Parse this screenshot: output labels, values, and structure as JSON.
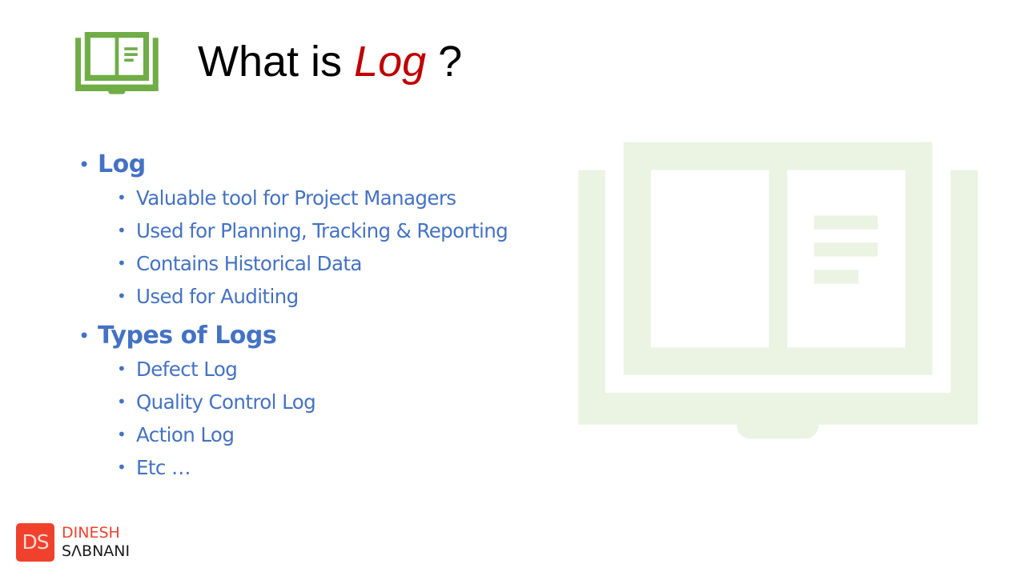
{
  "title": {
    "prefix": "What is ",
    "accent": "Log",
    "suffix": " ?"
  },
  "colors": {
    "accent": "#c00000",
    "bullet_text": "#4472c4",
    "icon_green": "#70ad47",
    "icon_bg_green": "#ebf3e3",
    "logo_red": "#f0412d"
  },
  "content": {
    "bullet_glyph": "•",
    "sections": [
      {
        "heading": "Log",
        "items": [
          "Valuable tool for Project Managers",
          "Used for Planning, Tracking & Reporting",
          "Contains Historical Data",
          "Used for Auditing"
        ]
      },
      {
        "heading": "Types of Logs",
        "items": [
          "Defect Log",
          "Quality Control Log",
          "Action Log",
          "Etc …"
        ]
      }
    ]
  },
  "icons": {
    "title_icon": "open-book-icon",
    "background_icon": "open-book-icon"
  },
  "logo": {
    "monogram": "DS",
    "first_name": "DINESH",
    "last_name": "SΛBNANI"
  }
}
